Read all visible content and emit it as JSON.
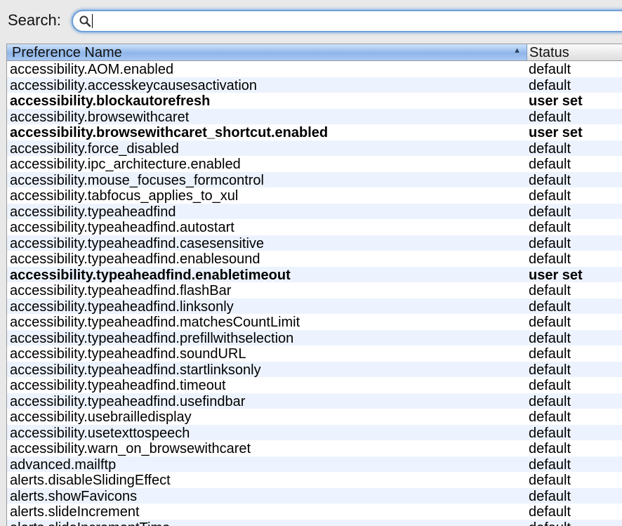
{
  "search": {
    "label": "Search:",
    "value": "",
    "placeholder": ""
  },
  "table": {
    "columns": {
      "name": "Preference Name",
      "status": "Status"
    },
    "sort_indicator": "▲",
    "rows": [
      {
        "name": "accessibility.AOM.enabled",
        "status": "default",
        "modified": false
      },
      {
        "name": "accessibility.accesskeycausesactivation",
        "status": "default",
        "modified": false
      },
      {
        "name": "accessibility.blockautorefresh",
        "status": "user set",
        "modified": true
      },
      {
        "name": "accessibility.browsewithcaret",
        "status": "default",
        "modified": false
      },
      {
        "name": "accessibility.browsewithcaret_shortcut.enabled",
        "status": "user set",
        "modified": true
      },
      {
        "name": "accessibility.force_disabled",
        "status": "default",
        "modified": false
      },
      {
        "name": "accessibility.ipc_architecture.enabled",
        "status": "default",
        "modified": false
      },
      {
        "name": "accessibility.mouse_focuses_formcontrol",
        "status": "default",
        "modified": false
      },
      {
        "name": "accessibility.tabfocus_applies_to_xul",
        "status": "default",
        "modified": false
      },
      {
        "name": "accessibility.typeaheadfind",
        "status": "default",
        "modified": false
      },
      {
        "name": "accessibility.typeaheadfind.autostart",
        "status": "default",
        "modified": false
      },
      {
        "name": "accessibility.typeaheadfind.casesensitive",
        "status": "default",
        "modified": false
      },
      {
        "name": "accessibility.typeaheadfind.enablesound",
        "status": "default",
        "modified": false
      },
      {
        "name": "accessibility.typeaheadfind.enabletimeout",
        "status": "user set",
        "modified": true
      },
      {
        "name": "accessibility.typeaheadfind.flashBar",
        "status": "default",
        "modified": false
      },
      {
        "name": "accessibility.typeaheadfind.linksonly",
        "status": "default",
        "modified": false
      },
      {
        "name": "accessibility.typeaheadfind.matchesCountLimit",
        "status": "default",
        "modified": false
      },
      {
        "name": "accessibility.typeaheadfind.prefillwithselection",
        "status": "default",
        "modified": false
      },
      {
        "name": "accessibility.typeaheadfind.soundURL",
        "status": "default",
        "modified": false
      },
      {
        "name": "accessibility.typeaheadfind.startlinksonly",
        "status": "default",
        "modified": false
      },
      {
        "name": "accessibility.typeaheadfind.timeout",
        "status": "default",
        "modified": false
      },
      {
        "name": "accessibility.typeaheadfind.usefindbar",
        "status": "default",
        "modified": false
      },
      {
        "name": "accessibility.usebrailledisplay",
        "status": "default",
        "modified": false
      },
      {
        "name": "accessibility.usetexttospeech",
        "status": "default",
        "modified": false
      },
      {
        "name": "accessibility.warn_on_browsewithcaret",
        "status": "default",
        "modified": false
      },
      {
        "name": "advanced.mailftp",
        "status": "default",
        "modified": false
      },
      {
        "name": "alerts.disableSlidingEffect",
        "status": "default",
        "modified": false
      },
      {
        "name": "alerts.showFavicons",
        "status": "default",
        "modified": false
      },
      {
        "name": "alerts.slideIncrement",
        "status": "default",
        "modified": false
      },
      {
        "name": "alerts.slideIncrementTime",
        "status": "default",
        "modified": false
      }
    ]
  },
  "colors": {
    "header_selected": "#8fb6ea",
    "row_alt": "#edf3fe",
    "focus_ring": "#6f9fd6"
  }
}
